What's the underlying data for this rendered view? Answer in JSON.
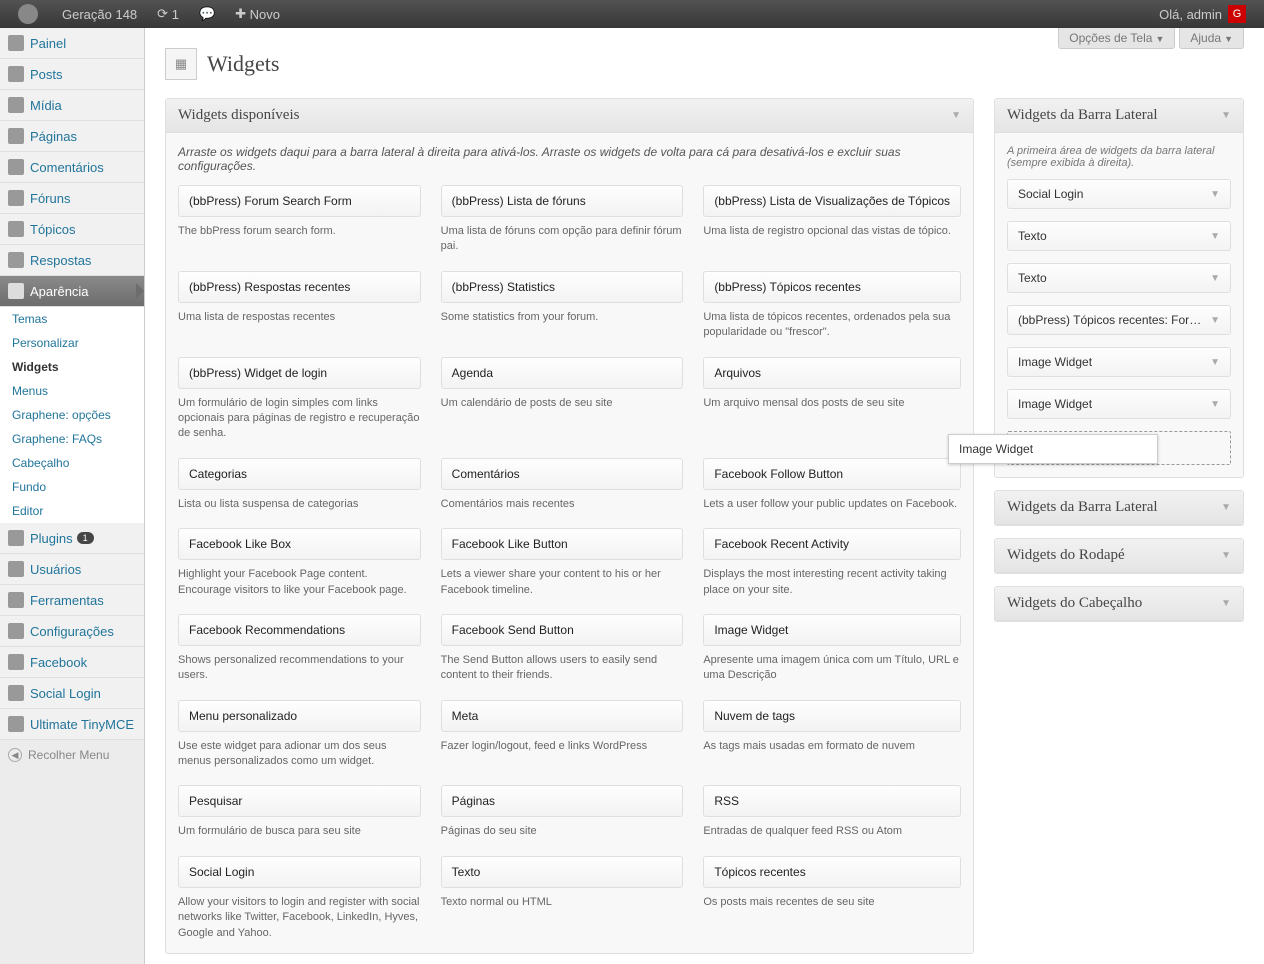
{
  "toolbar": {
    "site_name": "Geração 148",
    "updates": "1",
    "comments": "",
    "new_label": "Novo",
    "greeting": "Olá, admin",
    "gravatar_initial": "G"
  },
  "screen_options_label": "Opções de Tela",
  "help_label": "Ajuda",
  "page_title": "Widgets",
  "adminmenu": [
    {
      "label": "Painel",
      "icon": "dashboard"
    },
    {
      "label": "Posts",
      "icon": "posts"
    },
    {
      "label": "Mídia",
      "icon": "media"
    },
    {
      "label": "Páginas",
      "icon": "pages"
    },
    {
      "label": "Comentários",
      "icon": "comments"
    },
    {
      "label": "Fóruns",
      "icon": "forums"
    },
    {
      "label": "Tópicos",
      "icon": "topics"
    },
    {
      "label": "Respostas",
      "icon": "replies"
    },
    {
      "label": "Aparência",
      "icon": "appearance",
      "current": true,
      "submenu": [
        {
          "label": "Temas"
        },
        {
          "label": "Personalizar"
        },
        {
          "label": "Widgets",
          "current": true
        },
        {
          "label": "Menus"
        },
        {
          "label": "Graphene: opções"
        },
        {
          "label": "Graphene: FAQs"
        },
        {
          "label": "Cabeçalho"
        },
        {
          "label": "Fundo"
        },
        {
          "label": "Editor"
        }
      ]
    },
    {
      "label": "Plugins",
      "icon": "plugins",
      "badge": "1"
    },
    {
      "label": "Usuários",
      "icon": "users"
    },
    {
      "label": "Ferramentas",
      "icon": "tools"
    },
    {
      "label": "Configurações",
      "icon": "settings"
    },
    {
      "label": "Facebook",
      "icon": "facebook"
    },
    {
      "label": "Social Login",
      "icon": "social"
    },
    {
      "label": "Ultimate TinyMCE",
      "icon": "tinymce"
    }
  ],
  "collapse_label": "Recolher Menu",
  "available": {
    "title": "Widgets disponíveis",
    "desc": "Arraste os widgets daqui para a barra lateral à direita para ativá-los. Arraste os widgets de volta para cá para desativá-los e excluir suas configurações.",
    "widgets": [
      {
        "title": "(bbPress) Forum Search Form",
        "desc": "The bbPress forum search form."
      },
      {
        "title": "(bbPress) Lista de fóruns",
        "desc": "Uma lista de fóruns com opção para definir fórum pai."
      },
      {
        "title": "(bbPress) Lista de Visualizações de Tópicos",
        "desc": "Uma lista de registro opcional das vistas de tópico."
      },
      {
        "title": "(bbPress) Respostas recentes",
        "desc": "Uma lista de respostas recentes"
      },
      {
        "title": "(bbPress) Statistics",
        "desc": "Some statistics from your forum."
      },
      {
        "title": "(bbPress) Tópicos recentes",
        "desc": "Uma lista de tópicos recentes, ordenados pela sua popularidade ou \"frescor\"."
      },
      {
        "title": "(bbPress) Widget de login",
        "desc": "Um formulário de login simples com links opcionais para páginas de registro e recuperação de senha."
      },
      {
        "title": "Agenda",
        "desc": "Um calendário de posts de seu site"
      },
      {
        "title": "Arquivos",
        "desc": "Um arquivo mensal dos posts de seu site"
      },
      {
        "title": "Categorias",
        "desc": "Lista ou lista suspensa de categorias"
      },
      {
        "title": "Comentários",
        "desc": "Comentários mais recentes"
      },
      {
        "title": "Facebook Follow Button",
        "desc": "Lets a user follow your public updates on Facebook."
      },
      {
        "title": "Facebook Like Box",
        "desc": "Highlight your Facebook Page content. Encourage visitors to like your Facebook page."
      },
      {
        "title": "Facebook Like Button",
        "desc": "Lets a viewer share your content to his or her Facebook timeline."
      },
      {
        "title": "Facebook Recent Activity",
        "desc": "Displays the most interesting recent activity taking place on your site."
      },
      {
        "title": "Facebook Recommendations",
        "desc": "Shows personalized recommendations to your users."
      },
      {
        "title": "Facebook Send Button",
        "desc": "The Send Button allows users to easily send content to their friends."
      },
      {
        "title": "Image Widget",
        "desc": "Apresente uma imagem única com um Título, URL e uma Descrição"
      },
      {
        "title": "Menu personalizado",
        "desc": "Use este widget para adionar um dos seus menus personalizados como um widget."
      },
      {
        "title": "Meta",
        "desc": "Fazer login/logout, feed e links WordPress"
      },
      {
        "title": "Nuvem de tags",
        "desc": "As tags mais usadas em formato de nuvem"
      },
      {
        "title": "Pesquisar",
        "desc": "Um formulário de busca para seu site"
      },
      {
        "title": "Páginas",
        "desc": "Páginas do seu site"
      },
      {
        "title": "RSS",
        "desc": "Entradas de qualquer feed RSS ou Atom"
      },
      {
        "title": "Social Login",
        "desc": "Allow your visitors to login and register with social networks like Twitter, Facebook, LinkedIn, Hyves, Google and Yahoo."
      },
      {
        "title": "Texto",
        "desc": "Texto normal ou HTML"
      },
      {
        "title": "Tópicos recentes",
        "desc": "Os posts mais recentes de seu site"
      }
    ]
  },
  "sidebars": [
    {
      "title": "Widgets da Barra Lateral",
      "open": true,
      "desc": "A primeira área de widgets da barra lateral (sempre exibida à direita).",
      "widgets": [
        {
          "title": "Social Login"
        },
        {
          "title": "Texto"
        },
        {
          "title": "Texto"
        },
        {
          "title": "(bbPress) Tópicos recentes: Forum"
        },
        {
          "title": "Image Widget"
        },
        {
          "title": "Image Widget"
        }
      ],
      "dropzone": true,
      "dragging_label": "Image Widget"
    },
    {
      "title": "Widgets da Barra Lateral",
      "open": false
    },
    {
      "title": "Widgets do Rodapé",
      "open": false
    },
    {
      "title": "Widgets do Cabeçalho",
      "open": false
    }
  ]
}
